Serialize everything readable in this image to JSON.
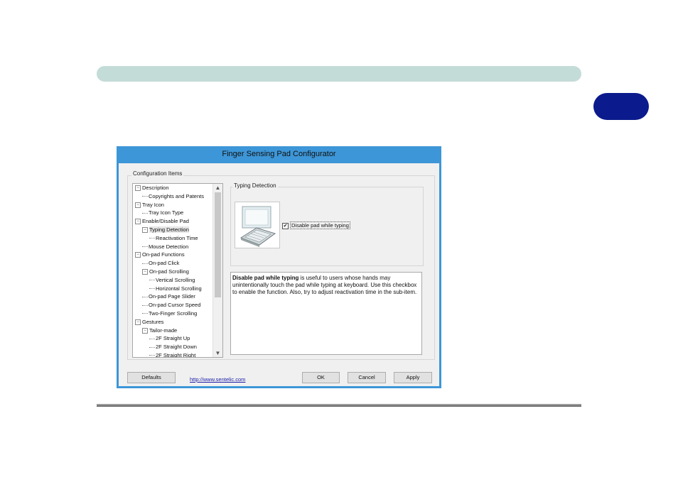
{
  "dialog": {
    "title": "Finger Sensing Pad Configurator",
    "group_label": "Configuration Items",
    "tree": [
      {
        "label": "Description",
        "level": 0,
        "expander": "⊟"
      },
      {
        "label": "Copyrights and Patents",
        "level": 1
      },
      {
        "label": "Tray Icon",
        "level": 0,
        "expander": "⊟"
      },
      {
        "label": "Tray Icon Type",
        "level": 1
      },
      {
        "label": "Enable/Disable Pad",
        "level": 0,
        "expander": "⊟"
      },
      {
        "label": "Typing Detection",
        "level": 1,
        "expander": "⊟",
        "selected": true
      },
      {
        "label": "Reactivation Time",
        "level": 2
      },
      {
        "label": "Mouse Detection",
        "level": 1
      },
      {
        "label": "On-pad Functions",
        "level": 0,
        "expander": "⊟"
      },
      {
        "label": "On-pad Click",
        "level": 1
      },
      {
        "label": "On-pad Scrolling",
        "level": 1,
        "expander": "⊟"
      },
      {
        "label": "Vertical Scrolling",
        "level": 2
      },
      {
        "label": "Horizontal Scrolling",
        "level": 2
      },
      {
        "label": "On-pad Page Slider",
        "level": 1
      },
      {
        "label": "On-pad Cursor Speed",
        "level": 1
      },
      {
        "label": "Two-Finger Scrolling",
        "level": 1
      },
      {
        "label": "Gestures",
        "level": 0,
        "expander": "⊟"
      },
      {
        "label": "Tailor-made",
        "level": 1,
        "expander": "⊟"
      },
      {
        "label": "2F Straight Up",
        "level": 2
      },
      {
        "label": "2F Straight Down",
        "level": 2
      },
      {
        "label": "2F Straight Right",
        "level": 2
      }
    ],
    "typing_detection_label": "Typing Detection",
    "checkbox_label": "Disable pad while typing",
    "checkbox_checked": true,
    "description_bold": "Disable pad while typing",
    "description_rest": " is useful to users whose hands may unintentionally touch the pad while typing at keyboard. Use this checkbox to enable the function. Also, try to adjust reactivation time in the sub-item.",
    "defaults_button": "Defaults",
    "link": "http://www.sentelic.com",
    "ok_button": "OK",
    "cancel_button": "Cancel",
    "apply_button": "Apply"
  },
  "colors": {
    "top_bar": "#c4dcd8",
    "chapter_tab": "#0b1a8c",
    "dialog_frame": "#3d96d7"
  }
}
